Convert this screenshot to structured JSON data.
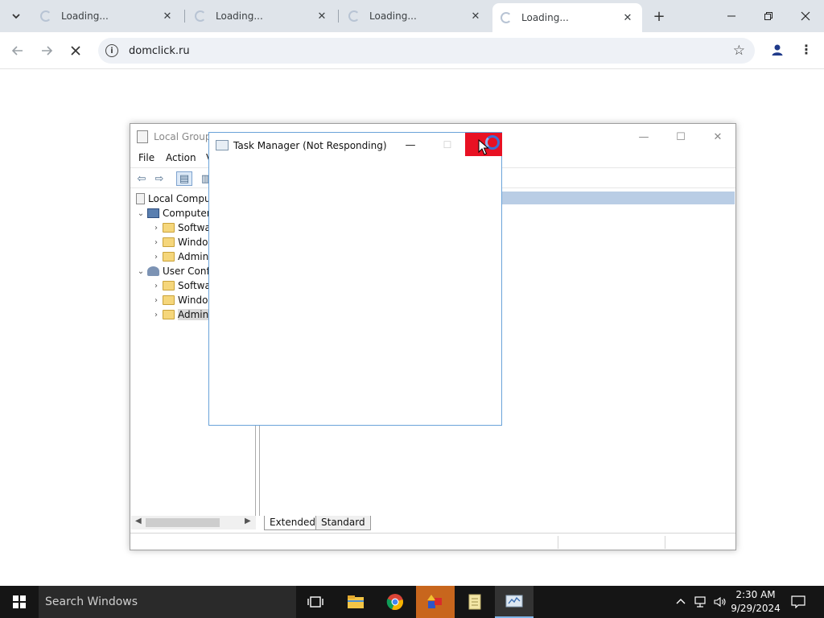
{
  "browser": {
    "tabs": [
      {
        "title": "Loading..."
      },
      {
        "title": "Loading..."
      },
      {
        "title": "Loading..."
      },
      {
        "title": "Loading...",
        "active": true
      }
    ],
    "url": "domclick.ru"
  },
  "gpedit": {
    "title": "Local Group",
    "menu": [
      "File",
      "Action",
      "V"
    ],
    "tree": [
      {
        "label": "Local Compu",
        "level": 0,
        "icon": "document-icon"
      },
      {
        "label": "Computer",
        "level": 1,
        "icon": "computer-icon",
        "expanded": true
      },
      {
        "label": "Softwa",
        "level": 2,
        "icon": "folder-icon"
      },
      {
        "label": "Windo",
        "level": 2,
        "icon": "folder-icon"
      },
      {
        "label": "Admin",
        "level": 2,
        "icon": "folder-icon"
      },
      {
        "label": "User Conf",
        "level": 1,
        "icon": "user-icon",
        "expanded": true
      },
      {
        "label": "Softwa",
        "level": 2,
        "icon": "folder-icon"
      },
      {
        "label": "Windo",
        "level": 2,
        "icon": "folder-icon"
      },
      {
        "label": "Admin",
        "level": 2,
        "icon": "folder-icon",
        "selected": true
      }
    ],
    "view_tabs": [
      "Extended",
      "Standard"
    ]
  },
  "task_manager": {
    "title": "Task Manager (Not Responding)"
  },
  "taskbar": {
    "search_placeholder": "Search Windows",
    "time": "2:30 AM",
    "date": "9/29/2024"
  },
  "colors": {
    "close_red": "#e81123",
    "tab_strip": "#dfe4ea",
    "taskbar": "#151515"
  }
}
